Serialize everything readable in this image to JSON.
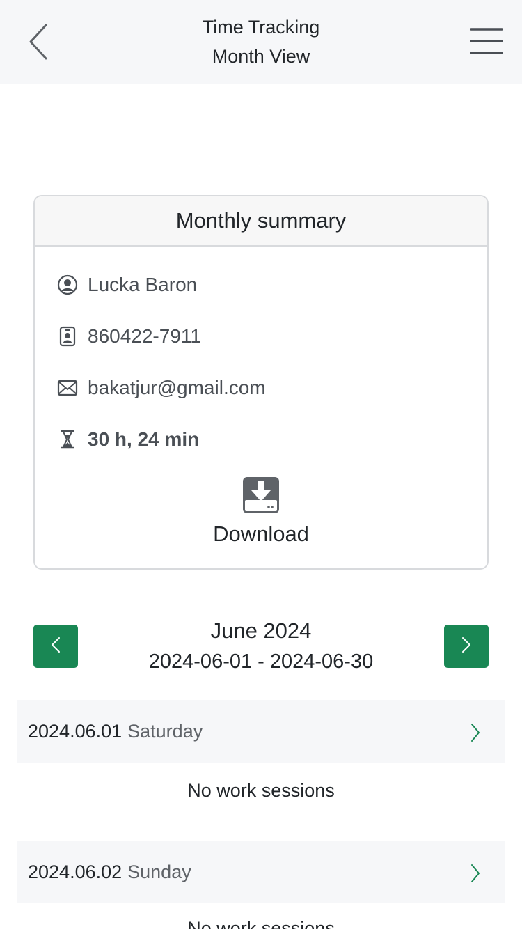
{
  "header": {
    "title_line1": "Time Tracking",
    "title_line2": "Month View",
    "back_icon": "chevron-left-icon",
    "menu_icon": "hamburger-menu-icon"
  },
  "summary": {
    "title": "Monthly summary",
    "name": "Lucka Baron",
    "id_number": "860422-7911",
    "email": "bakatjur@gmail.com",
    "total_time": "30 h, 24 min",
    "download_label": "Download",
    "icons": [
      "person-circle-icon",
      "id-badge-icon",
      "envelope-icon",
      "hourglass-icon",
      "download-tray-icon"
    ]
  },
  "month_nav": {
    "title": "June 2024",
    "range": "2024-06-01 - 2024-06-30",
    "accent_color": "#198754"
  },
  "days": [
    {
      "date": "2024.06.01",
      "weekday": "Saturday",
      "sessions_text": "No work sessions"
    },
    {
      "date": "2024.06.02",
      "weekday": "Sunday",
      "sessions_text": "No work sessions"
    }
  ]
}
